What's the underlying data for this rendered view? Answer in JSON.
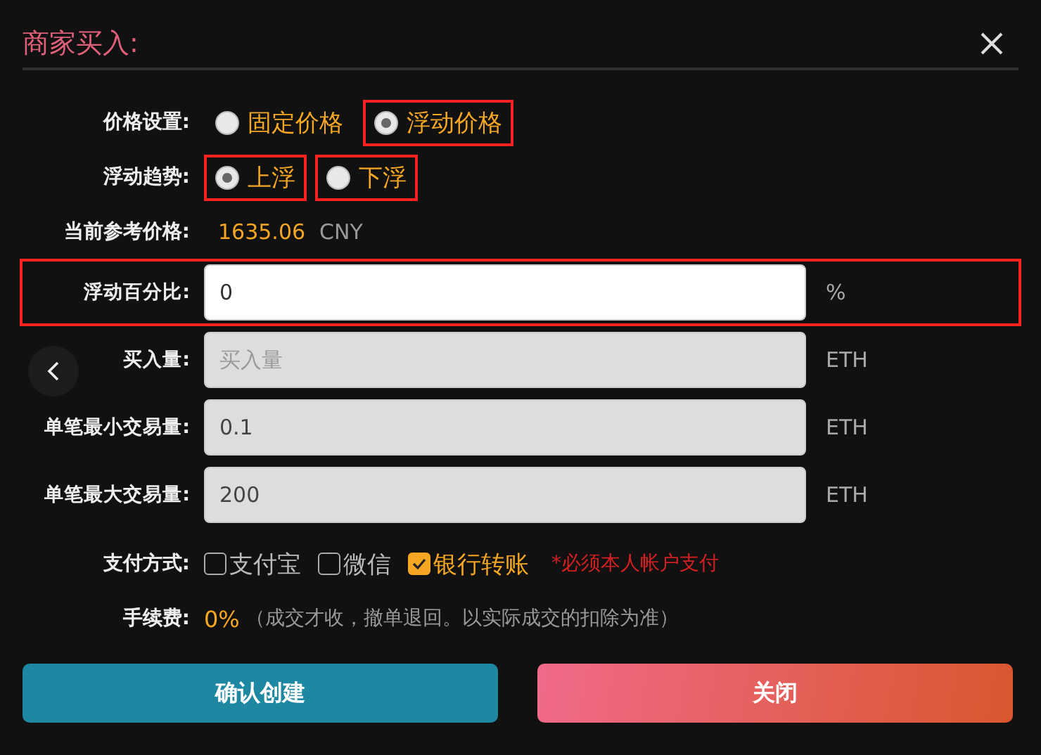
{
  "dialog": {
    "title": "商家买入:"
  },
  "price_setting": {
    "label": "价格设置:",
    "options": [
      {
        "label": "固定价格",
        "selected": false,
        "highlighted": false
      },
      {
        "label": "浮动价格",
        "selected": true,
        "highlighted": true
      }
    ]
  },
  "float_trend": {
    "label": "浮动趋势:",
    "options": [
      {
        "label": "上浮",
        "selected": true,
        "highlighted": true
      },
      {
        "label": "下浮",
        "selected": false,
        "highlighted": true
      }
    ]
  },
  "reference_price": {
    "label": "当前参考价格:",
    "value": "1635.06",
    "unit": "CNY"
  },
  "fields": [
    {
      "label": "浮动百分比:",
      "value": "0",
      "unit": "%",
      "disabled": false,
      "highlighted": true
    },
    {
      "label": "买入量:",
      "placeholder": "买入量",
      "unit": "ETH",
      "disabled": true,
      "highlighted": false
    },
    {
      "label": "单笔最小交易量:",
      "value": "0.1",
      "unit": "ETH",
      "disabled": true,
      "highlighted": false
    },
    {
      "label": "单笔最大交易量:",
      "value": "200",
      "unit": "ETH",
      "disabled": true,
      "highlighted": false
    }
  ],
  "payment": {
    "label": "支付方式:",
    "options": [
      {
        "label": "支付宝",
        "checked": false
      },
      {
        "label": "微信",
        "checked": false
      },
      {
        "label": "银行转账",
        "checked": true
      }
    ],
    "note": "*必须本人帐户支付"
  },
  "fee": {
    "label": "手续费:",
    "value": "0%",
    "note": "（成交才收，撤单退回。以实际成交的扣除为准）"
  },
  "buttons": [
    {
      "label": "确认创建",
      "kind": "confirm"
    },
    {
      "label": "关闭",
      "kind": "close"
    }
  ]
}
